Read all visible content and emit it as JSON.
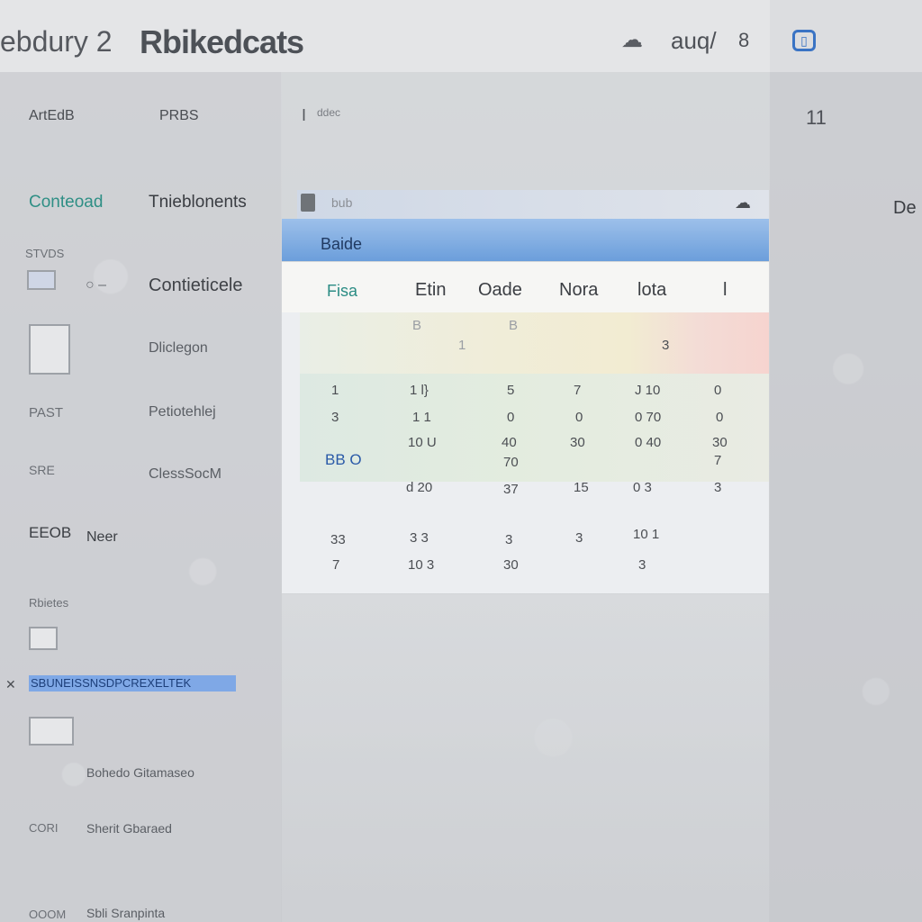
{
  "topbar": {
    "left_text": "ebdury 2",
    "title": "Rbikedcats",
    "icon": "cloud-icon",
    "label": "auq/",
    "stat": "8",
    "right_icon": "window-icon"
  },
  "sidebar": {
    "tabs": [
      "ArtEdB",
      "PRBS"
    ],
    "sections": [
      "Conteoad",
      "Tnieblonents"
    ],
    "items": [
      {
        "small": "STVDS",
        "label": "Contieticele",
        "big": true
      },
      {
        "small": "",
        "label": "Dliclegon"
      },
      {
        "small": "PAST",
        "label": "Petiotehlej"
      },
      {
        "small": "SRE",
        "label": "ClessSocM"
      },
      {
        "small": "EEOB",
        "label": "Neer"
      },
      {
        "small": "Rbietes",
        "label": ""
      },
      {
        "small": "",
        "label": "SBUNEISSNSDPCREXELTEK"
      },
      {
        "small": "",
        "label": "Bohedo Gitamaseo"
      },
      {
        "small": "CORI",
        "label": "Sherit Gbaraed"
      },
      {
        "small": "OOOM",
        "label": "Sbli Sranpinta"
      }
    ]
  },
  "main": {
    "caption": "ddec",
    "bar1_label": "bub",
    "bar2_label": "Baide",
    "columns": [
      "Fisa",
      "Etin",
      "Oade",
      "Nora",
      "lota",
      "l"
    ],
    "rows": [
      [
        "",
        "B",
        "",
        "B",
        "",
        "",
        ""
      ],
      [
        "",
        "1",
        "",
        "",
        "",
        "3",
        ""
      ],
      [
        "1",
        "1 l}",
        "5",
        "7",
        "J 10",
        "0"
      ],
      [
        "3",
        "1 1",
        "0",
        "0",
        "0 70",
        "0"
      ],
      [
        "BB O",
        "10 U",
        "40",
        "30",
        "0 40",
        "30"
      ],
      [
        "",
        "",
        "70",
        "",
        "",
        "7"
      ],
      [
        "",
        "d 20",
        "37",
        "15",
        "0 3",
        "3"
      ],
      [
        "33",
        "3 3",
        "3",
        "3",
        "10 1",
        ""
      ],
      [
        "7",
        "10 3",
        "30",
        "",
        "3",
        ""
      ]
    ]
  },
  "right_panel": {
    "icon_label": "11",
    "text": "De"
  }
}
